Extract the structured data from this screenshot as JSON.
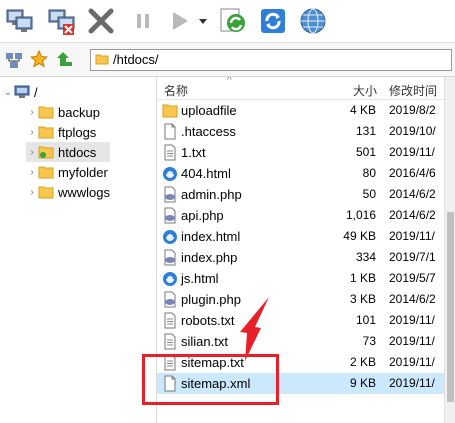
{
  "toolbar": {
    "buttons": [
      {
        "name": "connect-icon"
      },
      {
        "name": "disconnect-icon"
      },
      {
        "name": "close-icon"
      },
      {
        "name": "pause-icon"
      },
      {
        "name": "play-icon"
      },
      {
        "name": "dropdown-icon"
      },
      {
        "name": "sync-download-icon"
      },
      {
        "name": "refresh-icon"
      },
      {
        "name": "globe-icon"
      }
    ]
  },
  "address": {
    "path": "/htdocs/"
  },
  "tree": {
    "root": "/",
    "folders": [
      "backup",
      "ftplogs",
      "htdocs",
      "myfolder",
      "wwwlogs"
    ],
    "selected": "htdocs"
  },
  "columns": {
    "name": "名称",
    "size": "大小",
    "modified": "修改时间"
  },
  "files": [
    {
      "name": "uploadfile",
      "size": "4 KB",
      "date": "2019/8/2",
      "icon": "folder"
    },
    {
      "name": ".htaccess",
      "size": "131",
      "date": "2019/10/",
      "icon": "file"
    },
    {
      "name": "1.txt",
      "size": "501",
      "date": "2019/11/",
      "icon": "text"
    },
    {
      "name": "404.html",
      "size": "80",
      "date": "2016/4/6",
      "icon": "browser"
    },
    {
      "name": "admin.php",
      "size": "50",
      "date": "2014/6/2",
      "icon": "php"
    },
    {
      "name": "api.php",
      "size": "1,016",
      "date": "2014/6/2",
      "icon": "php"
    },
    {
      "name": "index.html",
      "size": "49 KB",
      "date": "2019/11/",
      "icon": "browser"
    },
    {
      "name": "index.php",
      "size": "334",
      "date": "2019/7/1",
      "icon": "php"
    },
    {
      "name": "js.html",
      "size": "1 KB",
      "date": "2019/5/7",
      "icon": "browser"
    },
    {
      "name": "plugin.php",
      "size": "3 KB",
      "date": "2014/6/2",
      "icon": "php"
    },
    {
      "name": "robots.txt",
      "size": "101",
      "date": "2019/11/",
      "icon": "text"
    },
    {
      "name": "silian.txt",
      "size": "73",
      "date": "2019/11/",
      "icon": "text"
    },
    {
      "name": "sitemap.txt",
      "size": "2 KB",
      "date": "2019/11/",
      "icon": "text"
    },
    {
      "name": "sitemap.xml",
      "size": "9 KB",
      "date": "2019/11/",
      "icon": "file",
      "selected": true
    }
  ],
  "colors": {
    "highlight": "#e8202a",
    "selection": "#cce8ff",
    "folder": "#f6c64e"
  }
}
